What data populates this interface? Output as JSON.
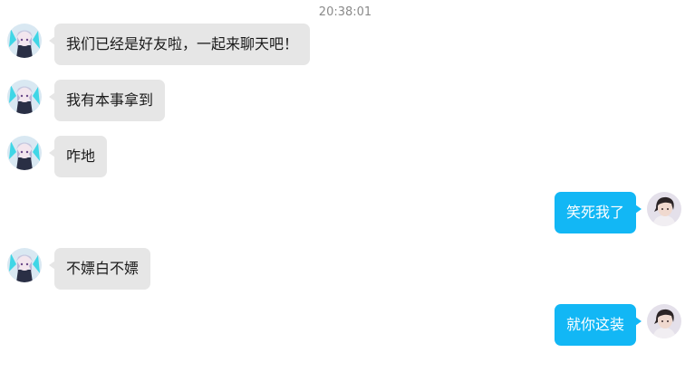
{
  "chat": {
    "timestamp": "20:38:01",
    "messages": [
      {
        "side": "left",
        "text": "我们已经是好友啦，一起来聊天吧！"
      },
      {
        "side": "left",
        "text": "我有本事拿到"
      },
      {
        "side": "left",
        "text": "咋地"
      },
      {
        "side": "right",
        "text": "笑死我了"
      },
      {
        "side": "left",
        "text": "不嫖白不嫖"
      },
      {
        "side": "right",
        "text": "就你这装"
      }
    ]
  },
  "avatars": {
    "left": "anime-character-avatar",
    "right": "person-photo-avatar"
  },
  "colors": {
    "incoming_bubble": "#e6e6e6",
    "outgoing_bubble": "#12b7f5",
    "timestamp": "#8a8a8a"
  }
}
